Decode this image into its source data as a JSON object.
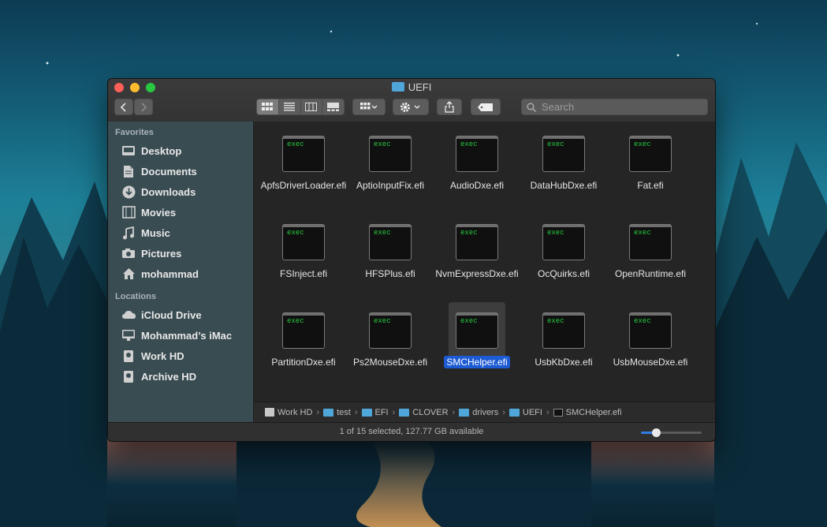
{
  "window": {
    "title": "UEFI",
    "search_placeholder": "Search"
  },
  "sidebar": {
    "sections": [
      {
        "title": "Favorites",
        "items": [
          {
            "label": "Desktop",
            "icon": "desktop-icon"
          },
          {
            "label": "Documents",
            "icon": "documents-icon"
          },
          {
            "label": "Downloads",
            "icon": "downloads-icon"
          },
          {
            "label": "Movies",
            "icon": "movies-icon"
          },
          {
            "label": "Music",
            "icon": "music-icon"
          },
          {
            "label": "Pictures",
            "icon": "pictures-icon"
          },
          {
            "label": "mohammad",
            "icon": "home-icon"
          }
        ]
      },
      {
        "title": "Locations",
        "items": [
          {
            "label": "iCloud Drive",
            "icon": "cloud-icon"
          },
          {
            "label": "Mohammad’s iMac",
            "icon": "imac-icon"
          },
          {
            "label": "Work HD",
            "icon": "drive-icon"
          },
          {
            "label": "Archive HD",
            "icon": "drive-icon"
          }
        ]
      }
    ]
  },
  "files": [
    {
      "name": "ApfsDriverLoader.efi",
      "icon_text": "exec"
    },
    {
      "name": "AptioInputFix.efi",
      "icon_text": "exec"
    },
    {
      "name": "AudioDxe.efi",
      "icon_text": "exec"
    },
    {
      "name": "DataHubDxe.efi",
      "icon_text": "exec"
    },
    {
      "name": "Fat.efi",
      "icon_text": "exec"
    },
    {
      "name": "FSInject.efi",
      "icon_text": "exec"
    },
    {
      "name": "HFSPlus.efi",
      "icon_text": "exec"
    },
    {
      "name": "NvmExpressDxe.efi",
      "icon_text": "exec"
    },
    {
      "name": "OcQuirks.efi",
      "icon_text": "exec"
    },
    {
      "name": "OpenRuntime.efi",
      "icon_text": "exec"
    },
    {
      "name": "PartitionDxe.efi",
      "icon_text": "exec"
    },
    {
      "name": "Ps2MouseDxe.efi",
      "icon_text": "exec"
    },
    {
      "name": "SMCHelper.efi",
      "icon_text": "exec",
      "selected": true
    },
    {
      "name": "UsbKbDxe.efi",
      "icon_text": "exec"
    },
    {
      "name": "UsbMouseDxe.efi",
      "icon_text": "exec"
    }
  ],
  "pathbar": [
    "Work HD",
    "test",
    "EFI",
    "CLOVER",
    "drivers",
    "UEFI",
    "SMCHelper.efi"
  ],
  "status": {
    "text": "1 of 15 selected, 127.77 GB available",
    "icon_size_level": 0.25
  },
  "colors": {
    "selection": "#1d5bd4",
    "folder": "#4fa6d9",
    "exec_text": "#27c93f"
  }
}
